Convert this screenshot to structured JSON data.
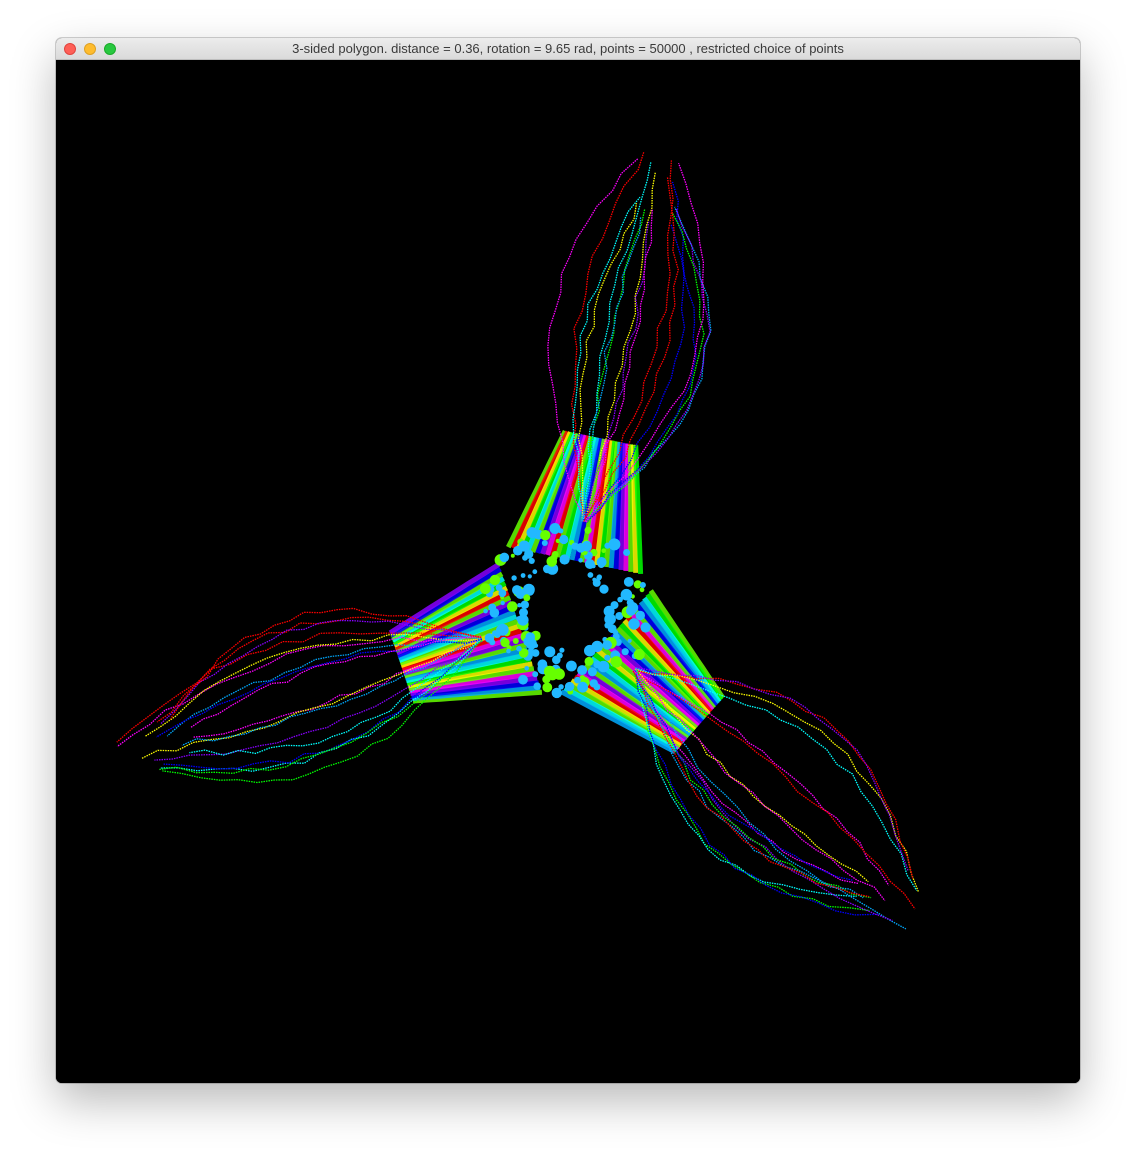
{
  "window": {
    "title": "3-sided polygon. distance = 0.36, rotation = 9.65 rad, points = 50000 , restricted choice of points"
  },
  "titlebar_buttons": {
    "close": "close-icon",
    "minimize": "minimize-icon",
    "zoom": "zoom-icon"
  },
  "canvas": {
    "background": "#000000",
    "palette": [
      "#ff00ff",
      "#ff0000",
      "#ffff00",
      "#00ff00",
      "#00ffff",
      "#00aaff",
      "#0000ff",
      "#8800ff"
    ],
    "core_color": "#22b8ff",
    "fill_color": "#66ff00"
  }
}
